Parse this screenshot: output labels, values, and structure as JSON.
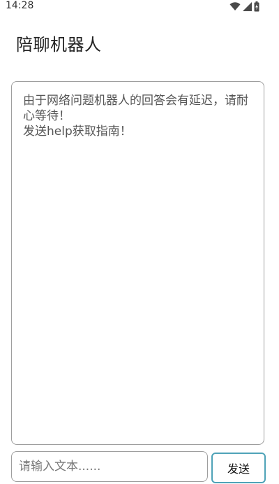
{
  "status_bar": {
    "time": "14:28",
    "icons": [
      "wifi-icon",
      "cellular-signal-icon",
      "battery-icon"
    ]
  },
  "app": {
    "title": "陪聊机器人"
  },
  "chat": {
    "message": "由于网络问题机器人的回答会有延迟，请耐心等待！\n发送help获取指南！"
  },
  "composer": {
    "input_value": "",
    "input_placeholder": "请输入文本......",
    "send_label": "发送"
  },
  "colors": {
    "border": "#9e9e9e",
    "send_border": "#4fa3b8",
    "background": "#ffffff"
  }
}
